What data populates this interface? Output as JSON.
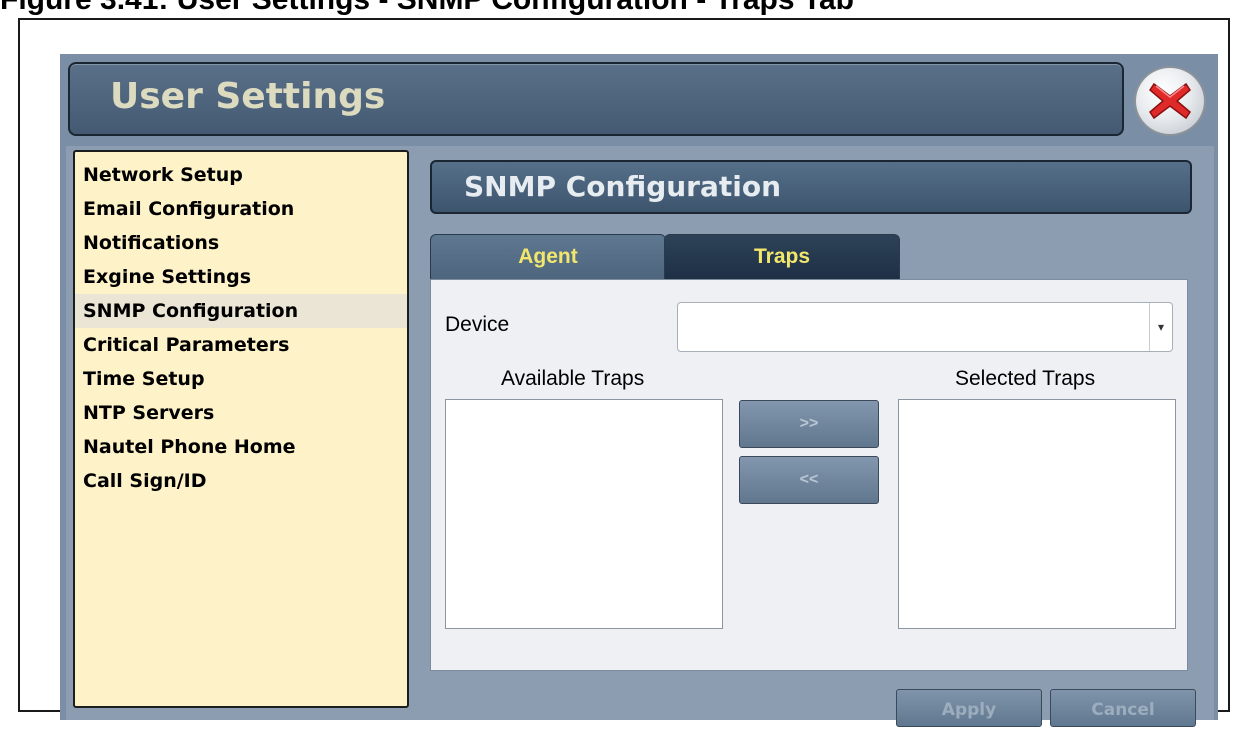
{
  "caption": "Figure 3.41: User Settings - SNMP Configuration - Traps Tab",
  "window": {
    "title": "User Settings",
    "close_icon": "close-x-icon"
  },
  "sidebar": {
    "items": [
      {
        "label": "Network Setup"
      },
      {
        "label": "Email Configuration"
      },
      {
        "label": "Notifications"
      },
      {
        "label": "Exgine Settings"
      },
      {
        "label": "SNMP Configuration",
        "selected": true
      },
      {
        "label": "Critical Parameters"
      },
      {
        "label": "Time Setup"
      },
      {
        "label": "NTP Servers"
      },
      {
        "label": "Nautel Phone Home"
      },
      {
        "label": "Call Sign/ID"
      }
    ]
  },
  "panel": {
    "title": "SNMP Configuration",
    "tabs": [
      {
        "label": "Agent"
      },
      {
        "label": "Traps",
        "active": true
      }
    ],
    "device": {
      "label": "Device",
      "value": "",
      "caret_icon": "dropdown-caret-icon"
    },
    "available_traps": {
      "label": "Available Traps",
      "items": []
    },
    "selected_traps": {
      "label": "Selected Traps",
      "items": []
    },
    "add_button": ">>",
    "remove_button": "<<",
    "apply_button": "Apply",
    "cancel_button": "Cancel"
  },
  "colors": {
    "title_text": "#dcdbc0",
    "tab_text": "#f2e76c",
    "sidebar_bg": "#fef2c9",
    "window_bg": "#7a8fa6"
  }
}
